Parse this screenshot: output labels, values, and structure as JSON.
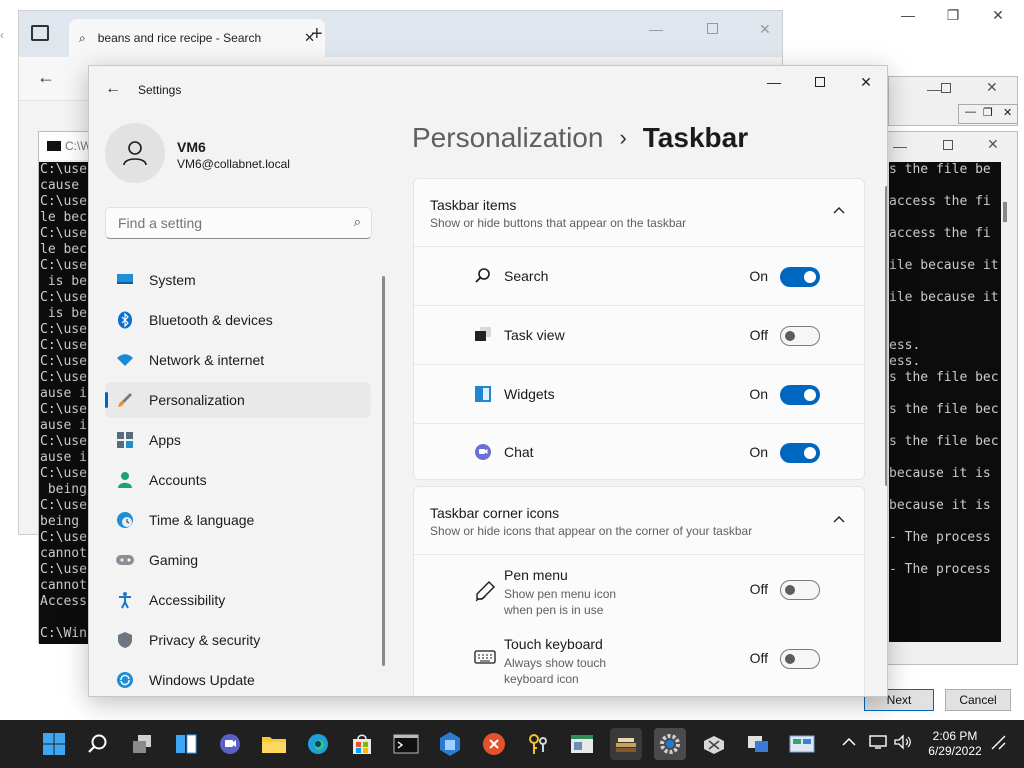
{
  "browser": {
    "tab_title": "beans and rice recipe - Search"
  },
  "console_left": {
    "title": "C:\\W",
    "lines": [
      "C:\\use",
      "cause",
      "C:\\use",
      "le bec",
      "C:\\use",
      "le bec",
      "C:\\use",
      " is be",
      "C:\\use",
      " is be",
      "C:\\use",
      "C:\\use",
      "C:\\use",
      "C:\\use",
      "ause i",
      "C:\\use",
      "ause i",
      "C:\\use",
      "ause i",
      "C:\\use",
      " being",
      "C:\\use",
      "being",
      "C:\\use",
      "cannot",
      "C:\\use",
      "cannot",
      "Access",
      "",
      "C:\\Win"
    ]
  },
  "console_right": {
    "lines": [
      "s the file be",
      "",
      "access the fi",
      "",
      "access the fi",
      "",
      "ile because it",
      "",
      "ile because it",
      "",
      "",
      "ess.",
      "ess.",
      "s the file bec",
      "",
      "s the file bec",
      "",
      "s the file bec",
      "",
      "because it is",
      "",
      "because it is",
      "",
      "- The process",
      "",
      "- The process"
    ]
  },
  "wizard": {
    "next_label": "Next",
    "cancel_label": "Cancel"
  },
  "settings": {
    "app_title": "Settings",
    "user_name": "VM6",
    "user_email": "VM6@collabnet.local",
    "search_placeholder": "Find a setting",
    "breadcrumb_parent": "Personalization",
    "breadcrumb_separator": "›",
    "page_title": "Taskbar",
    "nav": [
      {
        "label": "System",
        "icon": "monitor-icon"
      },
      {
        "label": "Bluetooth & devices",
        "icon": "bluetooth-icon"
      },
      {
        "label": "Network & internet",
        "icon": "wifi-icon"
      },
      {
        "label": "Personalization",
        "icon": "brush-icon",
        "active": true
      },
      {
        "label": "Apps",
        "icon": "apps-icon"
      },
      {
        "label": "Accounts",
        "icon": "person-icon"
      },
      {
        "label": "Time & language",
        "icon": "globe-clock-icon"
      },
      {
        "label": "Gaming",
        "icon": "gamepad-icon"
      },
      {
        "label": "Accessibility",
        "icon": "accessibility-icon"
      },
      {
        "label": "Privacy & security",
        "icon": "shield-icon"
      },
      {
        "label": "Windows Update",
        "icon": "update-icon"
      }
    ],
    "taskbar_items": {
      "title": "Taskbar items",
      "subtitle": "Show or hide buttons that appear on the taskbar",
      "rows": [
        {
          "label": "Search",
          "state": "On",
          "on": true,
          "icon": "search-icon"
        },
        {
          "label": "Task view",
          "state": "Off",
          "on": false,
          "icon": "task-view-icon"
        },
        {
          "label": "Widgets",
          "state": "On",
          "on": true,
          "icon": "widgets-icon"
        },
        {
          "label": "Chat",
          "state": "On",
          "on": true,
          "icon": "chat-icon"
        }
      ]
    },
    "corner_icons": {
      "title": "Taskbar corner icons",
      "subtitle": "Show or hide icons that appear on the corner of your taskbar",
      "rows": [
        {
          "label": "Pen menu",
          "sub": "Show pen menu icon when pen is in use",
          "state": "Off",
          "on": false,
          "icon": "pen-icon"
        },
        {
          "label": "Touch keyboard",
          "sub": "Always show touch keyboard icon",
          "state": "Off",
          "on": false,
          "icon": "keyboard-icon"
        }
      ]
    }
  },
  "taskbar": {
    "time": "2:06 PM",
    "date": "6/29/2022"
  },
  "colors": {
    "accent": "#0067c0",
    "taskbar_bg": "#202020",
    "settings_bg": "#f3f3f3"
  }
}
